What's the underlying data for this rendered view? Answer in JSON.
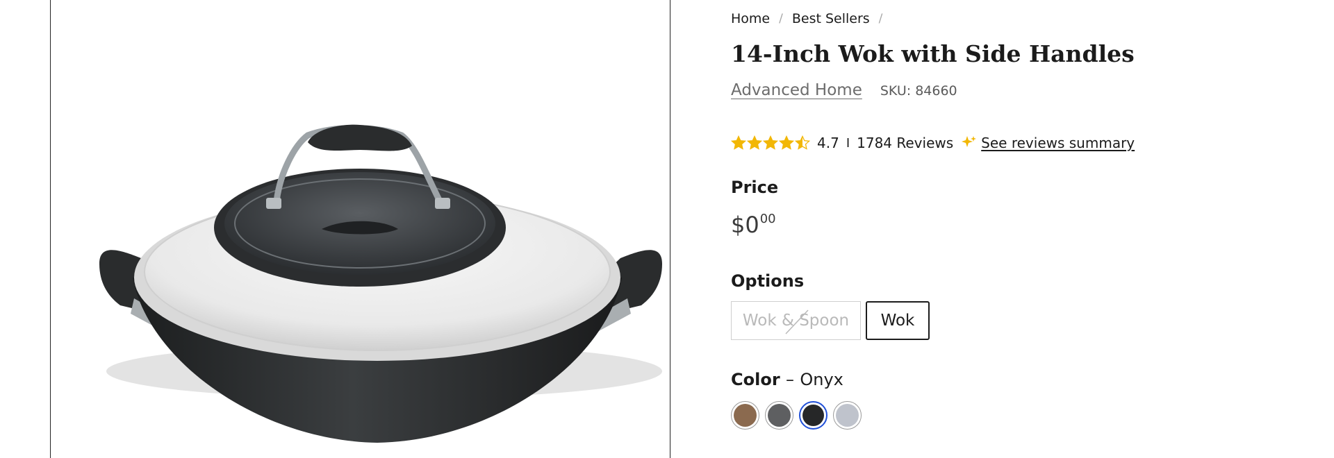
{
  "product_image": {
    "alt": "14-Inch Wok with Side Handles"
  },
  "breadcrumb": [
    {
      "label": "Home"
    },
    {
      "label": "Best Sellers"
    }
  ],
  "breadcrumb_separator": "/",
  "product": {
    "title": "14-Inch Wok with Side Handles",
    "brand": "Advanced Home",
    "sku": "SKU: 84660"
  },
  "rating": {
    "value": "4.7",
    "stars_filled": 4.5,
    "stars_max": 5,
    "star_color": "#f2b705",
    "separator": "I",
    "reviews": "1784 Reviews",
    "summary_link": "See reviews summary",
    "summary_icon": "sparkle-icon"
  },
  "price": {
    "label": "Price",
    "currency": "$",
    "dollars": "0",
    "cents": "00"
  },
  "options": {
    "label": "Options",
    "items": [
      {
        "label": "Wok & Spoon",
        "available": false,
        "selected": false
      },
      {
        "label": "Wok",
        "available": true,
        "selected": true
      }
    ]
  },
  "color": {
    "label": "Color",
    "dash": "–",
    "selected_name": "Onyx",
    "swatches": [
      {
        "color": "#8b6a4f",
        "selected": false
      },
      {
        "color": "#5e5f61",
        "selected": false
      },
      {
        "color": "#262728",
        "selected": true
      },
      {
        "color": "#bfc3cc",
        "selected": false
      }
    ],
    "selected_border": "#1f4fd8"
  }
}
